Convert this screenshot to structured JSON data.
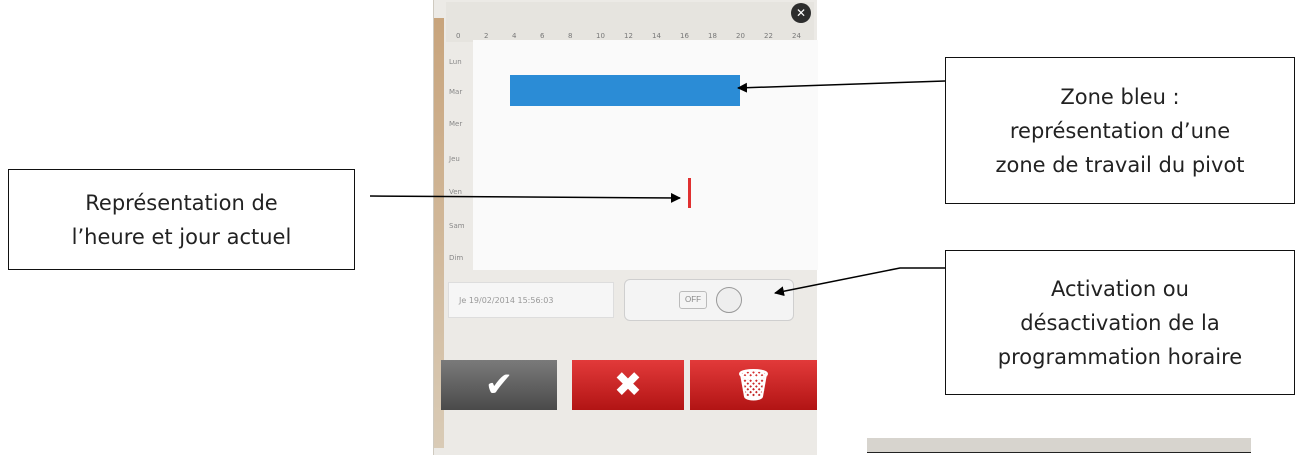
{
  "callouts": {
    "zone_bleu": "Zone bleu :\nreprésentation d’une\nzone de travail du pivot",
    "heure": "Représentation de\nl’heure et jour actuel",
    "activation": "Activation ou\ndésactivation de la\nprogrammation horaire"
  },
  "device": {
    "ruler_ticks": [
      "0",
      "2",
      "4",
      "6",
      "8",
      "10",
      "12",
      "14",
      "16",
      "18",
      "20",
      "22",
      "24"
    ],
    "day_labels": [
      "Lun",
      "Mar",
      "Mer",
      "Jeu",
      "Ven",
      "Sam",
      "Dim"
    ],
    "date_text": "Je 19/02/2014 15:56:03",
    "toggle_label": "OFF",
    "close_glyph": "✕",
    "ok_glyph": "✔",
    "cancel_glyph": "✖",
    "delete_glyph": "🗑"
  },
  "colors": {
    "zone": "#2b8cd6",
    "now_marker": "#e03030",
    "cancel": "#c41e1e",
    "ok": "#5a5a5a"
  }
}
